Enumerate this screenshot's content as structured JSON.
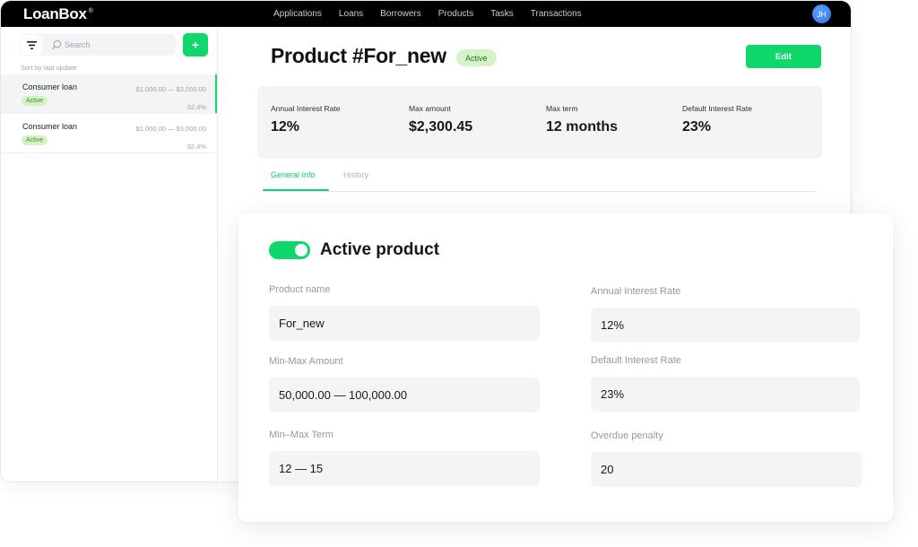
{
  "app": {
    "logo": "LoanBox",
    "logo_mark": "®",
    "nav": [
      "Applications",
      "Loans",
      "Borrowers",
      "Products",
      "Tasks",
      "Transactions"
    ],
    "user_initials": "JH"
  },
  "sidebar": {
    "search_placeholder": "Search",
    "add_label": "+",
    "sort_label": "Sort by last update",
    "items": [
      {
        "name": "Consumer loan",
        "range": "$1,000.00 — $3,000.00",
        "status": "Active",
        "rate": "32,4%",
        "selected": true
      },
      {
        "name": "Consumer loan",
        "range": "$1,000.00 — $3,000.00",
        "status": "Active",
        "rate": "32,4%",
        "selected": false
      }
    ]
  },
  "product": {
    "title": "Product #For_new",
    "status": "Active",
    "edit_label": "Edit",
    "stats": [
      {
        "label": "Annual Interest Rate",
        "value": "12%"
      },
      {
        "label": "Max amount",
        "value": "$2,300.45"
      },
      {
        "label": "Max term",
        "value": "12 months"
      },
      {
        "label": "Default Interest Rate",
        "value": "23%"
      }
    ],
    "tabs": [
      {
        "label": "General Info",
        "active": true
      },
      {
        "label": "History",
        "active": false
      }
    ]
  },
  "form": {
    "toggle_on": true,
    "title": "Active product",
    "fields": {
      "product_name": {
        "label": "Product name",
        "value": "For_new"
      },
      "min_max_amount": {
        "label": "Min-Max Amount",
        "value": "50,000.00 — 100,000.00"
      },
      "min_max_term": {
        "label": "Min–Max Term",
        "value": "12 — 15"
      },
      "annual_interest_rate": {
        "label": "Annual Interest Rate",
        "value": "12%"
      },
      "default_interest_rate": {
        "label": "Default Interest Rate",
        "value": "23%"
      },
      "overdue_penalty": {
        "label": "Overdue penalty",
        "value": "20"
      }
    }
  },
  "colors": {
    "accent": "#10d769",
    "badge_bg": "#d5f3c6",
    "topbar": "#000000",
    "avatar": "#2f6ff0"
  }
}
